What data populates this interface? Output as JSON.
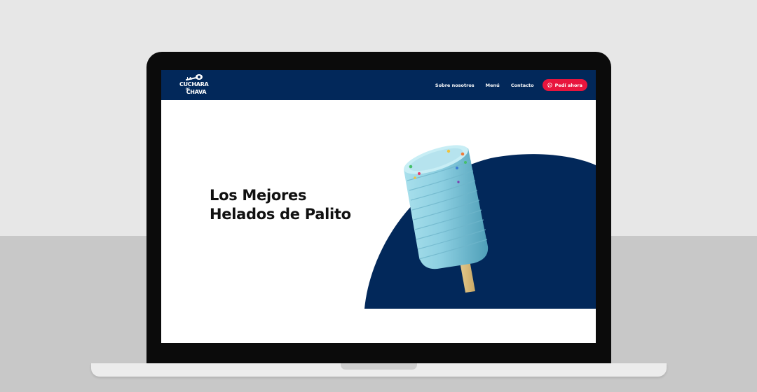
{
  "site": {
    "logo": {
      "line1": "LA",
      "line2": "CUCHARA",
      "line3": "DE",
      "line4": "CHAVA"
    },
    "nav": {
      "items": [
        {
          "label": "Sobre nosotros"
        },
        {
          "label": "Menú"
        },
        {
          "label": "Contacto"
        }
      ],
      "cta_label": "Pedí ahora"
    },
    "hero": {
      "title_line1": "Los Mejores",
      "title_line2": "Helados de Palito"
    }
  },
  "colors": {
    "header_bg": "#02285a",
    "cta_bg": "#e8153d",
    "blob": "#02285a",
    "popsicle": "#8fd0e0"
  },
  "icons": {
    "cta_icon": "whatsapp-icon",
    "logo_icon": "spoon-icon"
  }
}
